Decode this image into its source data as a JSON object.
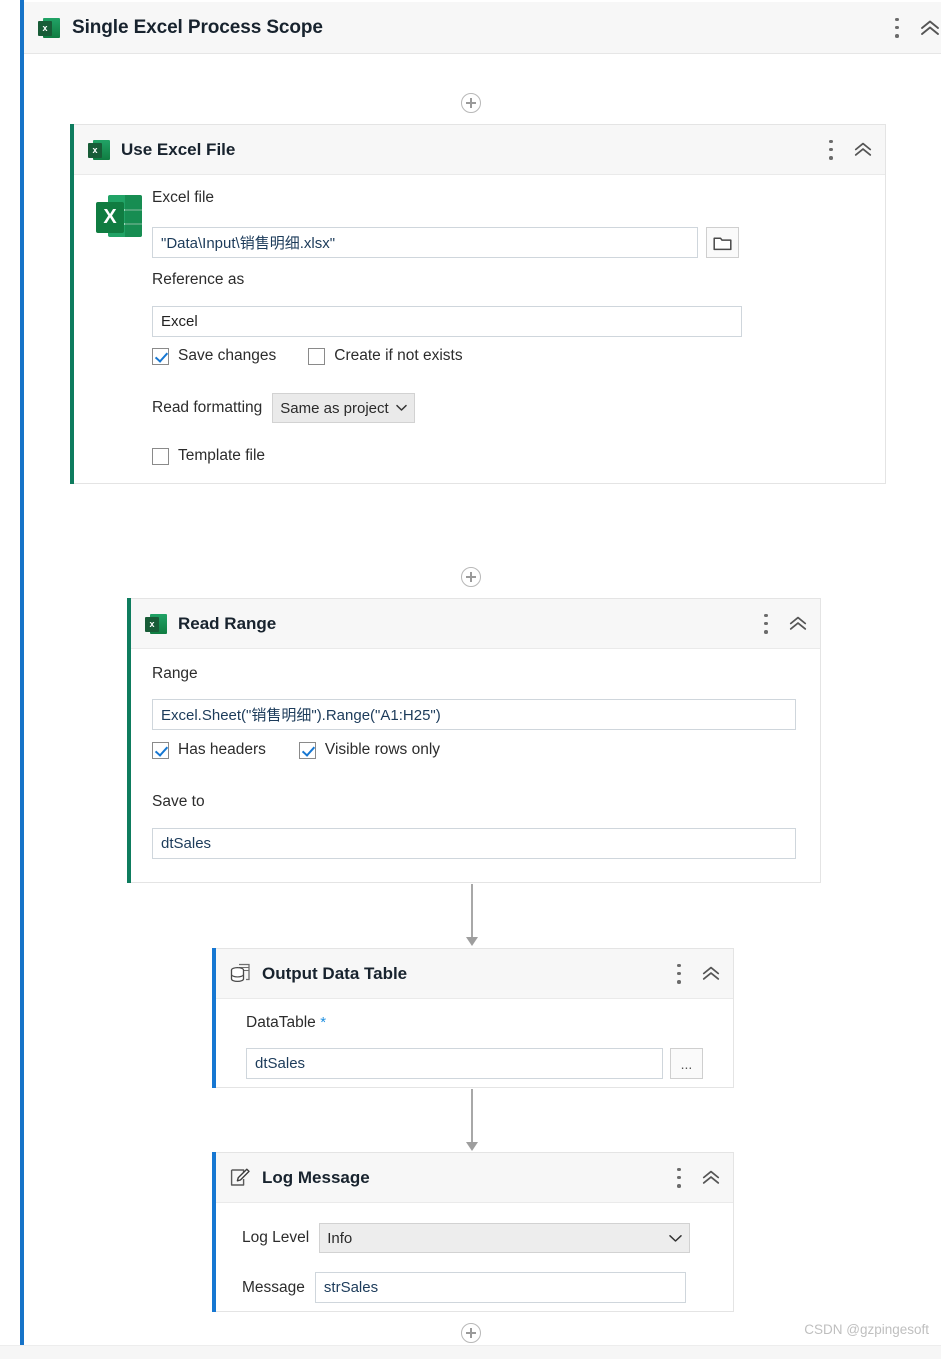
{
  "scope": {
    "title": "Single Excel Process Scope",
    "icon": "excel-icon",
    "menu_icon": "kebab-menu-icon",
    "collapse_icon": "double-chevron-up-icon"
  },
  "connectors": {
    "add_label": "+",
    "top_add": "add-activity-icon",
    "bottom_add": "add-activity-icon"
  },
  "use_excel_file": {
    "title": "Use Excel File",
    "icon": "excel-icon",
    "excel_file_label": "Excel file",
    "excel_file_value": "\"Data\\Input\\销售明细.xlsx\"",
    "browse_icon": "folder-icon",
    "reference_as_label": "Reference as",
    "reference_as_value": "Excel",
    "save_changes_label": "Save changes",
    "save_changes_checked": true,
    "create_if_not_exists_label": "Create if not exists",
    "create_if_not_exists_checked": false,
    "read_formatting_label": "Read formatting",
    "read_formatting_value": "Same as project",
    "template_file_label": "Template file",
    "template_file_checked": false
  },
  "read_range": {
    "title": "Read Range",
    "icon": "excel-icon",
    "range_label": "Range",
    "range_value": "Excel.Sheet(\"销售明细\").Range(\"A1:H25\")",
    "has_headers_label": "Has headers",
    "has_headers_checked": true,
    "visible_rows_only_label": "Visible rows only",
    "visible_rows_only_checked": true,
    "save_to_label": "Save to",
    "save_to_value": "dtSales"
  },
  "output_data_table": {
    "title": "Output Data Table",
    "icon": "data-table-icon",
    "datatable_label": "DataTable",
    "required_mark": "*",
    "datatable_value": "dtSales",
    "more_button_label": "..."
  },
  "log_message": {
    "title": "Log Message",
    "icon": "pencil-edit-icon",
    "log_level_label": "Log Level",
    "log_level_value": "Info",
    "message_label": "Message",
    "message_value": "strSales"
  },
  "watermark": "CSDN @gzpingesoft",
  "colors": {
    "scope_accent": "#1673C8",
    "excel_accent": "#0E7C5E",
    "blue_accent": "#1677D2",
    "checkbox_check": "#1677D2",
    "required_star": "#1F8FE0",
    "excel_green": "#107C41"
  }
}
